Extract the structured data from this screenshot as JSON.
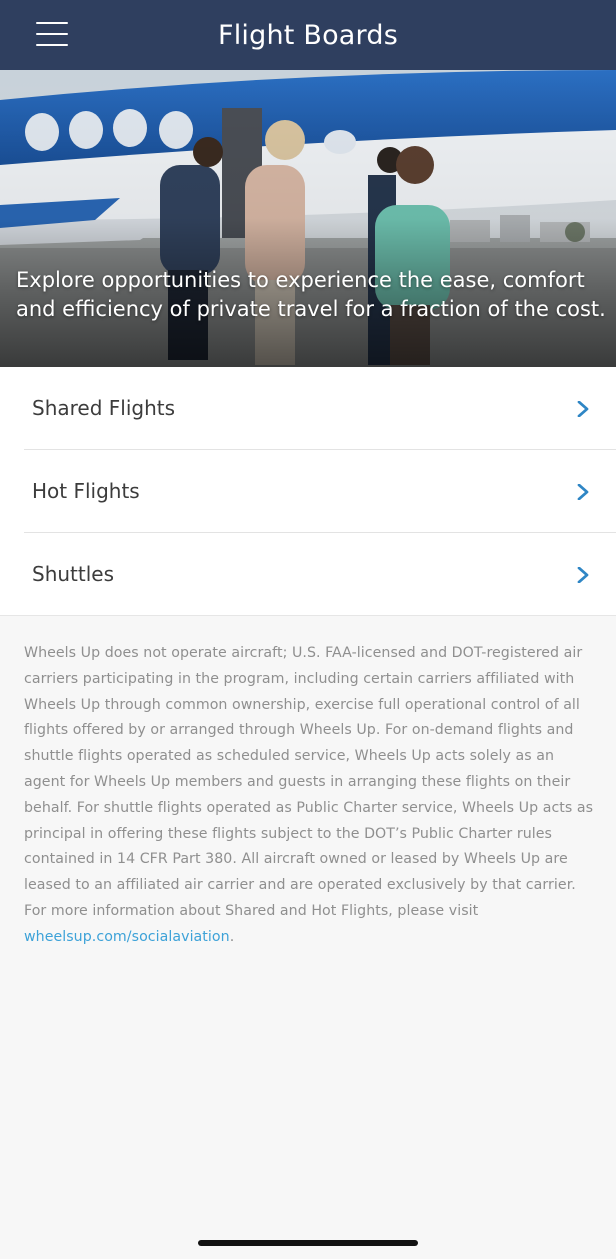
{
  "header": {
    "title": "Flight Boards",
    "menu_icon": "hamburger-menu-icon",
    "background_color": "#2f3f5f"
  },
  "hero": {
    "caption": "Explore opportunities to experience the ease, comfort and efficiency of private travel for a fraction of the cost.",
    "image": "passengers-boarding-private-jet"
  },
  "menu": {
    "items": [
      {
        "label": "Shared Flights",
        "icon": "chevron-right-icon"
      },
      {
        "label": "Hot Flights",
        "icon": "chevron-right-icon"
      },
      {
        "label": "Shuttles",
        "icon": "chevron-right-icon"
      }
    ],
    "chevron_color": "#2f86c5"
  },
  "disclaimer": {
    "text": "Wheels Up does not operate aircraft; U.S. FAA-licensed and DOT-registered air carriers participating in the program, including certain carriers affiliated with Wheels Up through common ownership, exercise full operational control of all flights offered by or arranged through Wheels Up. For on-demand flights and shuttle flights operated as scheduled service, Wheels Up acts solely as an agent for Wheels Up members and guests in arranging these flights on their behalf. For shuttle flights operated as Public Charter service, Wheels Up acts as principal in offering these flights subject to the DOT’s Public Charter rules contained in 14 CFR Part 380. All aircraft owned or leased by Wheels Up are leased to an affiliated air carrier and are operated exclusively by that carrier. For more information about Shared and Hot Flights, please visit ",
    "link_text": "wheelsup.com/socialaviation",
    "after_link": ".",
    "link_color": "#3da2d8"
  }
}
